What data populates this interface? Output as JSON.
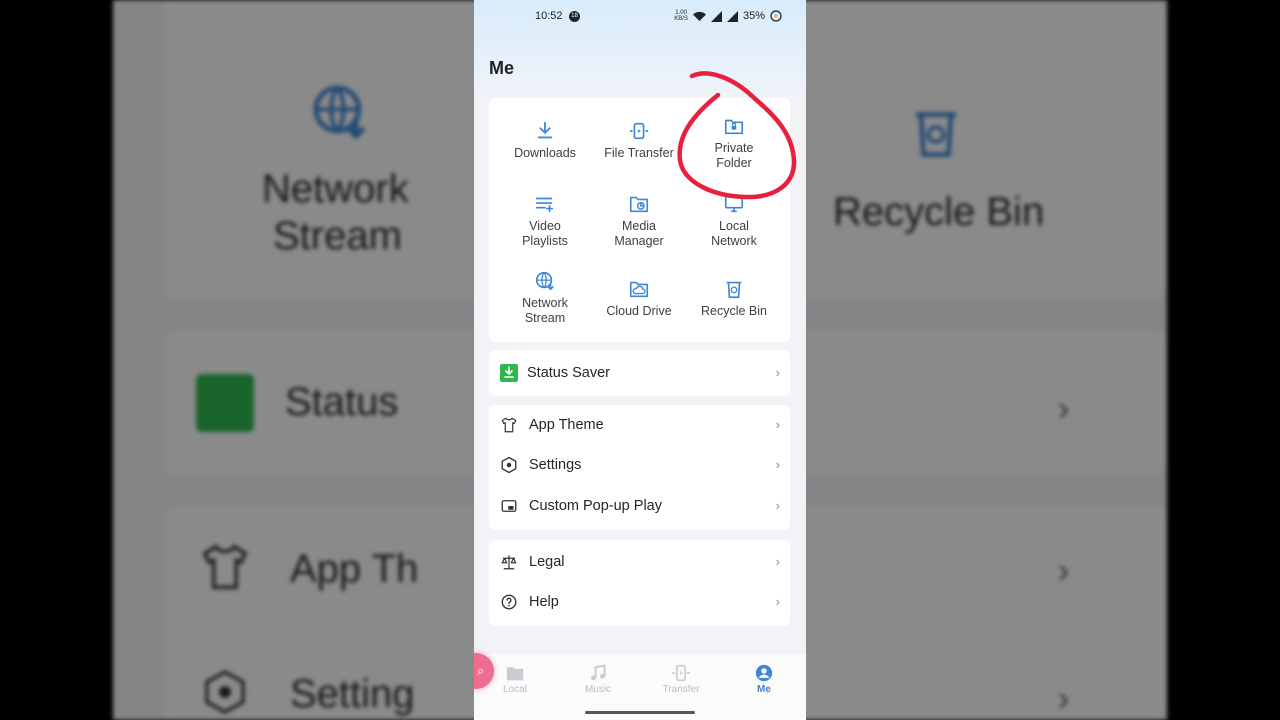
{
  "status_bar": {
    "time": "10:52",
    "notification_badge": "18",
    "speed_value": "1.00",
    "speed_unit": "KB/S",
    "battery": "35%"
  },
  "page": {
    "title": "Me"
  },
  "tools": [
    {
      "label": "Downloads",
      "icon": "download-icon"
    },
    {
      "label": "File Transfer",
      "icon": "file-transfer-icon"
    },
    {
      "label": "Private Folder",
      "icon": "private-folder-icon"
    },
    {
      "label": "Video Playlists",
      "icon": "playlist-icon"
    },
    {
      "label": "Media Manager",
      "icon": "media-manager-icon"
    },
    {
      "label": "Local Network",
      "icon": "monitor-icon"
    },
    {
      "label": "Network Stream",
      "icon": "network-stream-icon"
    },
    {
      "label": "Cloud Drive",
      "icon": "cloud-drive-icon"
    },
    {
      "label": "Recycle Bin",
      "icon": "recycle-bin-icon"
    }
  ],
  "status_saver": {
    "label": "Status Saver",
    "icon": "status-saver-icon"
  },
  "prefs": [
    {
      "label": "App Theme",
      "icon": "shirt-icon"
    },
    {
      "label": "Settings",
      "icon": "settings-icon"
    },
    {
      "label": "Custom Pop-up Play",
      "icon": "popup-play-icon"
    }
  ],
  "info": [
    {
      "label": "Legal",
      "icon": "scales-icon"
    },
    {
      "label": "Help",
      "icon": "help-icon"
    }
  ],
  "chevron": "›",
  "tabs": [
    {
      "label": "Local",
      "icon": "folder-icon",
      "active": false
    },
    {
      "label": "Music",
      "icon": "music-icon",
      "active": false
    },
    {
      "label": "Transfer",
      "icon": "transfer-icon",
      "active": false
    },
    {
      "label": "Me",
      "icon": "person-icon",
      "active": true
    }
  ],
  "fab": {
    "icon": "search-icon"
  },
  "background": {
    "text_1": "Network",
    "text_2": "Stream",
    "text_3": "Recycle Bin",
    "text_4": "Status",
    "text_5": "App Th",
    "text_6": "Setting"
  },
  "colors": {
    "accent": "#3f86d4",
    "annotation": "#e8203e",
    "status_saver_green": "#2fb84f",
    "fab_pink": "#ef6c91"
  }
}
